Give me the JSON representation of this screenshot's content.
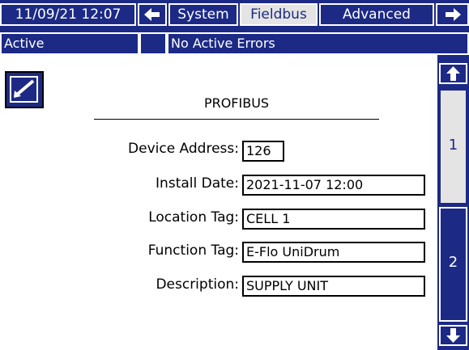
{
  "header": {
    "datetime": "11/09/21 12:07",
    "tabs": [
      {
        "label": "System",
        "active": false
      },
      {
        "label": "Fieldbus",
        "active": true
      },
      {
        "label": "Advanced",
        "active": false
      }
    ],
    "left_arrow_icon": "arrow-left-icon",
    "right_arrow_icon": "arrow-right-icon"
  },
  "status": {
    "mode": "Active",
    "message": "No Active Errors"
  },
  "panel": {
    "title": "PROFIBUS",
    "edit_icon": "edit-icon",
    "fields": [
      {
        "label": "Device Address:",
        "value": "126"
      },
      {
        "label": "Install Date:",
        "value": "2021-11-07 12:00"
      },
      {
        "label": "Location Tag:",
        "value": "CELL 1"
      },
      {
        "label": "Function Tag:",
        "value": "E-Flo UniDrum"
      },
      {
        "label": "Description:",
        "value": "SUPPLY UNIT"
      }
    ]
  },
  "pager": {
    "pages": [
      {
        "label": "1",
        "active": true
      },
      {
        "label": "2",
        "active": false
      }
    ],
    "up_icon": "arrow-up-icon",
    "down_icon": "arrow-down-icon"
  },
  "colors": {
    "navy": "#1c2a85",
    "selected_bg": "#e4e4e4",
    "text": "#000000"
  }
}
